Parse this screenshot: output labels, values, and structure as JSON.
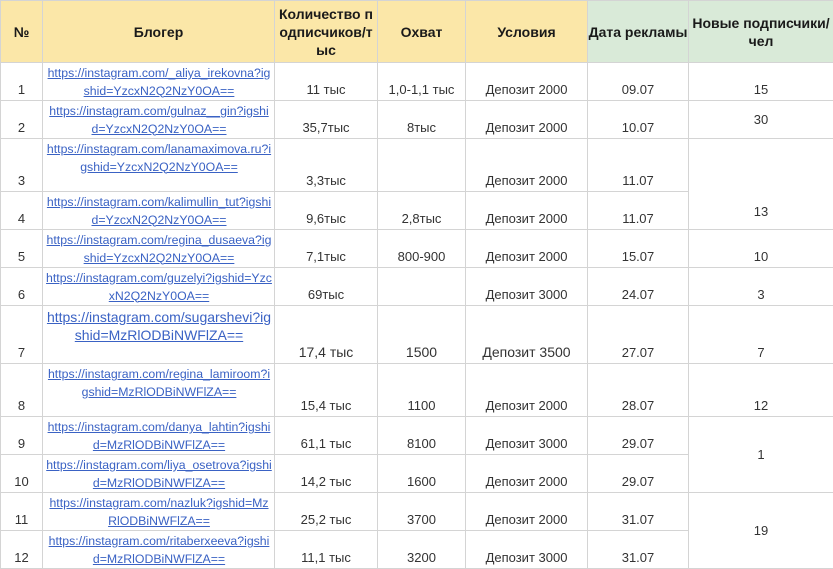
{
  "headers": {
    "num": "№",
    "blogger": "Блогер",
    "followers": "Количество подписчиков/тыс",
    "reach": "Охват",
    "terms": "Условия",
    "date": "Дата рекламы",
    "new_subs": "Новые подписчики/чел"
  },
  "rows": [
    {
      "num": "1",
      "link": "https://instagram.com/_aliya_irekovna?igshid=YzcxN2Q2NzY0OA==",
      "followers": "11 тыс",
      "reach": "1,0-1,1 тыс",
      "terms": "Депозит 2000",
      "date": "09.07"
    },
    {
      "num": "2",
      "link": "https://instagram.com/gulnaz__gin?igshid=YzcxN2Q2NzY0OA==",
      "followers": "35,7тыс",
      "reach": "8тыс",
      "terms": "Депозит 2000",
      "date": "10.07"
    },
    {
      "num": "3",
      "link": "https://instagram.com/lanamaximova.ru?igshid=YzcxN2Q2NzY0OA==",
      "followers": "3,3тыс",
      "reach": "",
      "terms": "Депозит 2000",
      "date": "11.07"
    },
    {
      "num": "4",
      "link": "https://instagram.com/kalimullin_tut?igshid=YzcxN2Q2NzY0OA==",
      "followers": "9,6тыс",
      "reach": "2,8тыс",
      "terms": "Депозит 2000",
      "date": "11.07"
    },
    {
      "num": "5",
      "link": "https://instagram.com/regina_dusaeva?igshid=YzcxN2Q2NzY0OA==",
      "followers": "7,1тыс",
      "reach": "800-900",
      "terms": "Депозит 2000",
      "date": "15.07"
    },
    {
      "num": "6",
      "link": "https://instagram.com/guzelyi?igshid=YzcxN2Q2NzY0OA==",
      "followers": "69тыс",
      "reach": "",
      "terms": "Депозит 3000",
      "date": "24.07"
    },
    {
      "num": "7",
      "link": "https://instagram.com/sugarshevi?igshid=MzRlODBiNWFlZA==",
      "followers": "17,4 тыс",
      "reach": "1500",
      "terms": "Депозит 3500",
      "date": "27.07"
    },
    {
      "num": "8",
      "link": "https://instagram.com/regina_lamiroom?igshid=MzRlODBiNWFlZA==",
      "followers": "15,4 тыс",
      "reach": "1100",
      "terms": "Депозит 2000",
      "date": "28.07"
    },
    {
      "num": "9",
      "link": "https://instagram.com/danya_lahtin?igshid=MzRlODBiNWFlZA==",
      "followers": "61,1 тыс",
      "reach": "8100",
      "terms": "Депозит 3000",
      "date": "29.07"
    },
    {
      "num": "10",
      "link": "https://instagram.com/liya_osetrova?igshid=MzRlODBiNWFlZA==",
      "followers": "14,2 тыс",
      "reach": "1600",
      "terms": "Депозит 2000",
      "date": "29.07"
    },
    {
      "num": "11",
      "link": "https://instagram.com/nazluk?igshid=MzRlODBiNWFlZA==",
      "followers": "25,2 тыс",
      "reach": "3700",
      "terms": "Депозит 2000",
      "date": "31.07"
    },
    {
      "num": "12",
      "link": "https://instagram.com/ritaberxeeva?igshid=MzRlODBiNWFlZA==",
      "followers": "11,1 тыс",
      "reach": "3200",
      "terms": "Депозит 3000",
      "date": "31.07"
    }
  ],
  "new_subs": {
    "r1": "15",
    "r2": "30",
    "r3_4": "13",
    "r5": "10",
    "r6": "3",
    "r7": "7",
    "r8": "12",
    "r9_10": "1",
    "r11_12": "19"
  }
}
